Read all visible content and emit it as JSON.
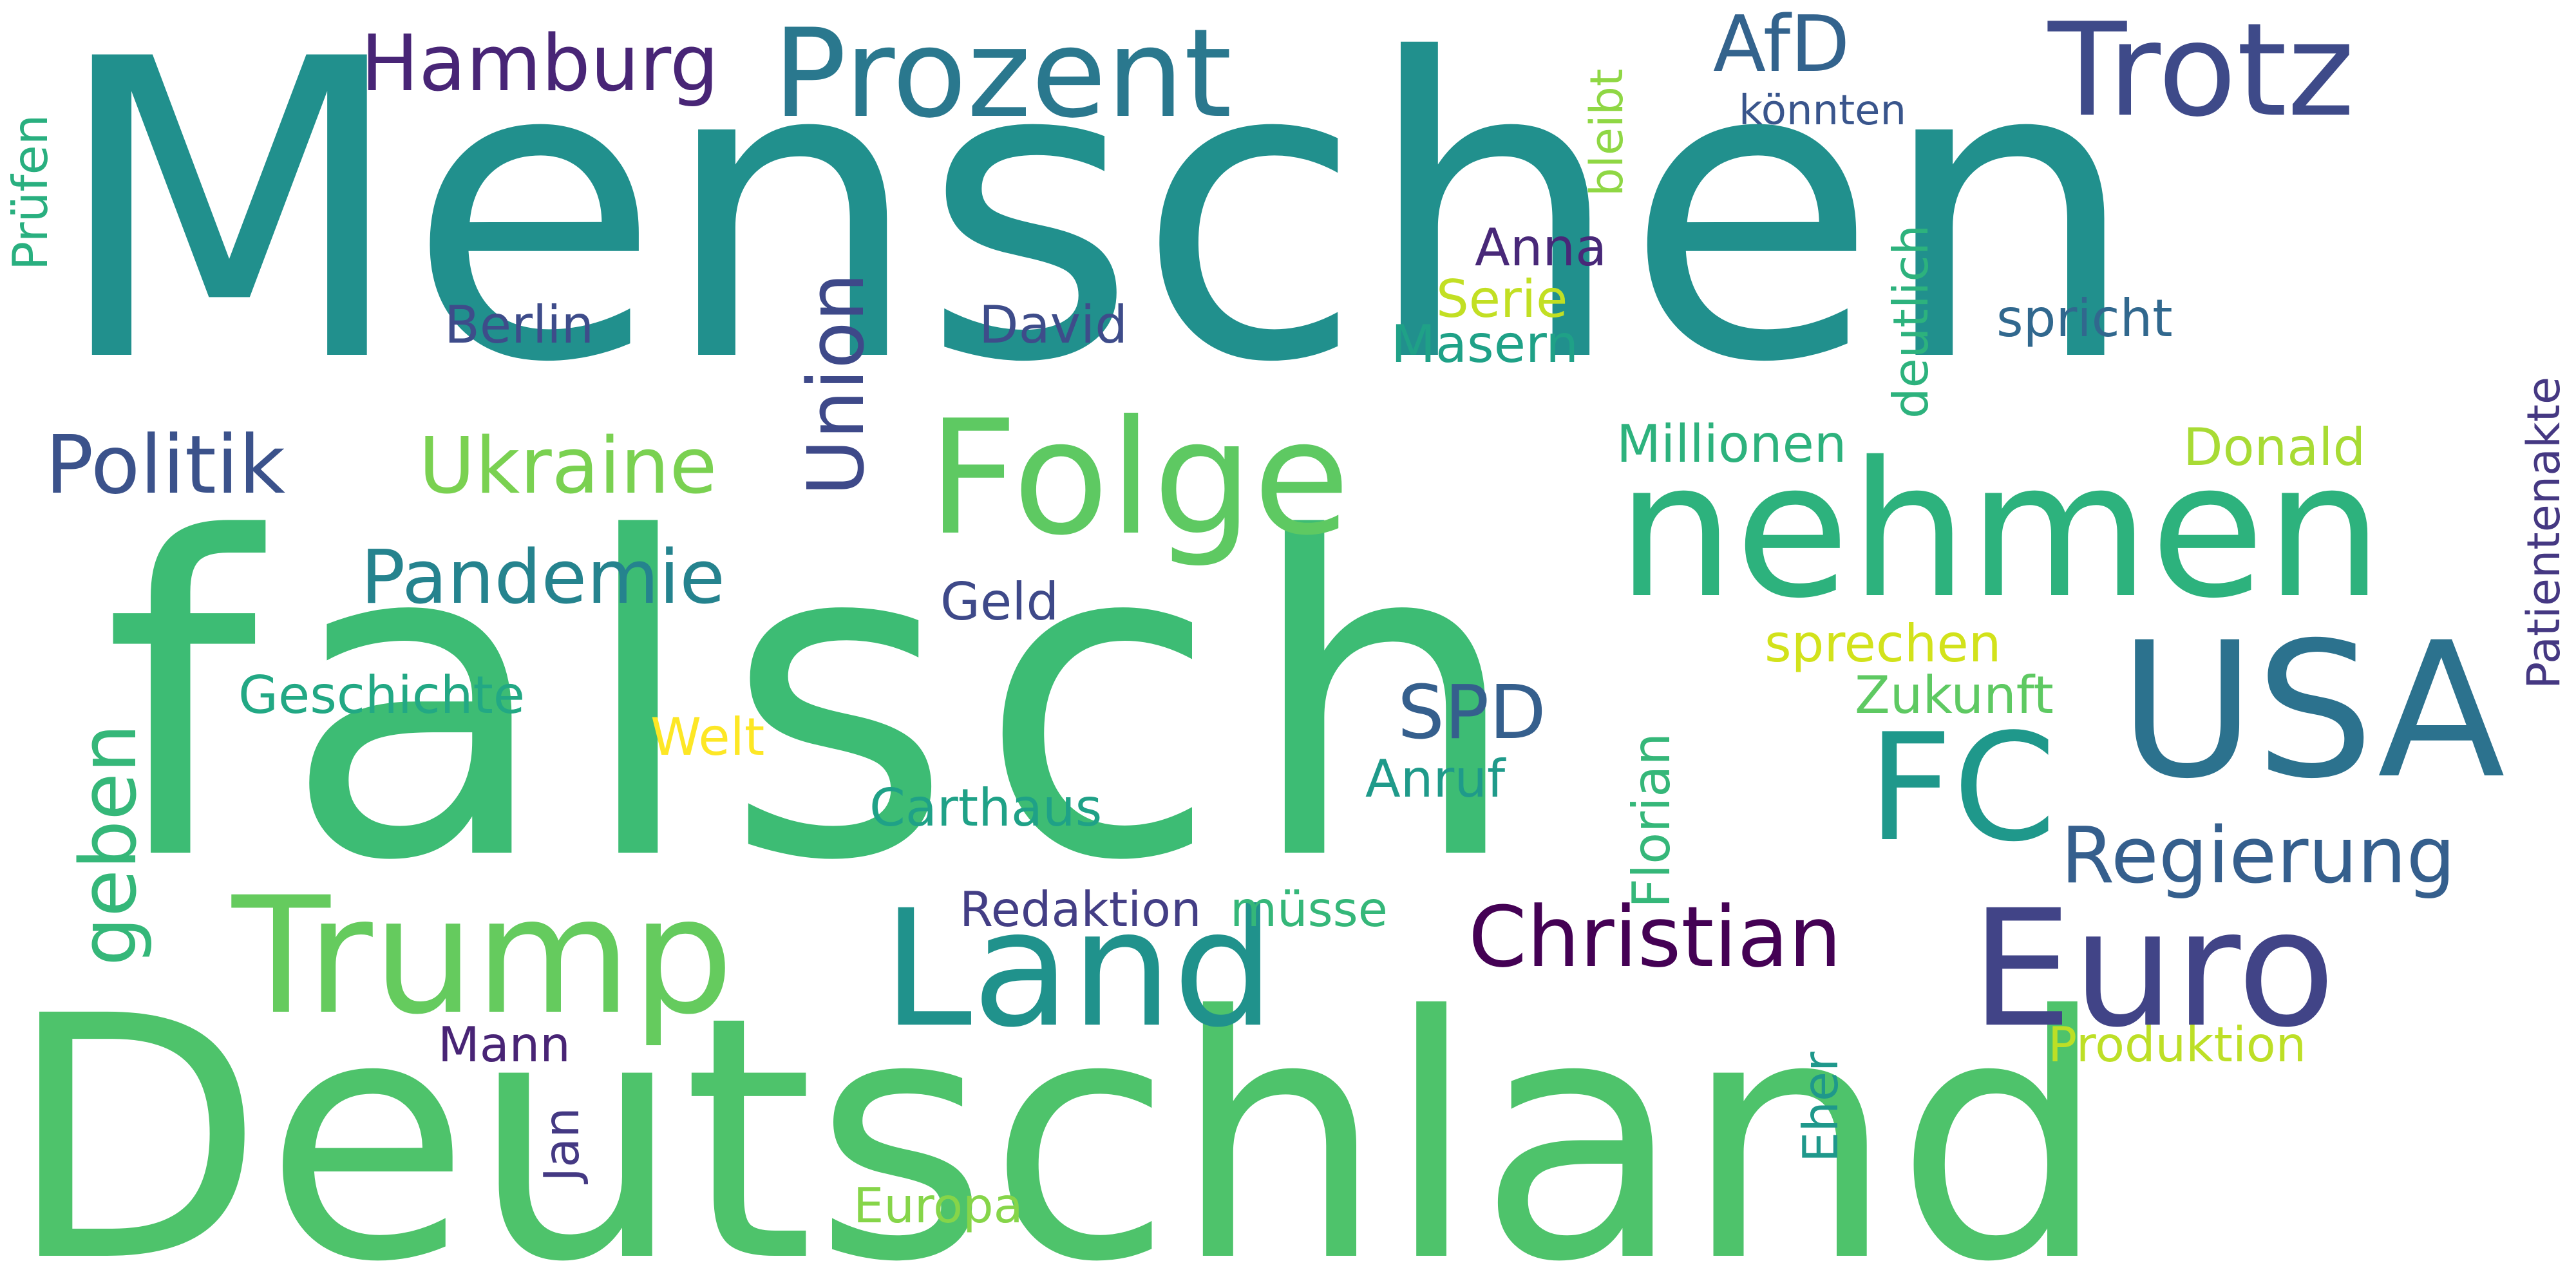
{
  "words": {
    "menschen": "Menschen",
    "falsch": "falsch",
    "deutschland": "Deutschland",
    "prozent": "Prozent",
    "trotz": "Trotz",
    "hamburg": "Hamburg",
    "afd": "AfD",
    "koennten": "könnten",
    "pruefen": "Prüfen",
    "bleibt": "bleibt",
    "anna": "Anna",
    "serie": "Serie",
    "masern": "Masern",
    "berlin": "Berlin",
    "david": "David",
    "deutlich": "deutlich",
    "spricht": "spricht",
    "patientenakte": "Patientenakte",
    "union": "Union",
    "folge": "Folge",
    "politik": "Politik",
    "ukraine": "Ukraine",
    "millionen": "Millionen",
    "donald": "Donald",
    "nehmen": "nehmen",
    "pandemie": "Pandemie",
    "geld": "Geld",
    "sprechen": "sprechen",
    "zukunft": "Zukunft",
    "geschichte": "Geschichte",
    "welt": "Welt",
    "spd": "SPD",
    "usa": "USA",
    "fc": "FC",
    "florian": "Florian",
    "anruf": "Anruf",
    "carthaus": "Carthaus",
    "regierung": "Regierung",
    "geben": "geben",
    "trump": "Trump",
    "redaktion": "Redaktion",
    "muesse": "müsse",
    "land": "Land",
    "christian": "Christian",
    "euro": "Euro",
    "mann": "Mann",
    "produktion": "Produktion",
    "jan": "Jan",
    "eher": "Eher",
    "europa": "Europa"
  },
  "colors": {
    "background": "#ffffff",
    "palette": "viridis"
  }
}
